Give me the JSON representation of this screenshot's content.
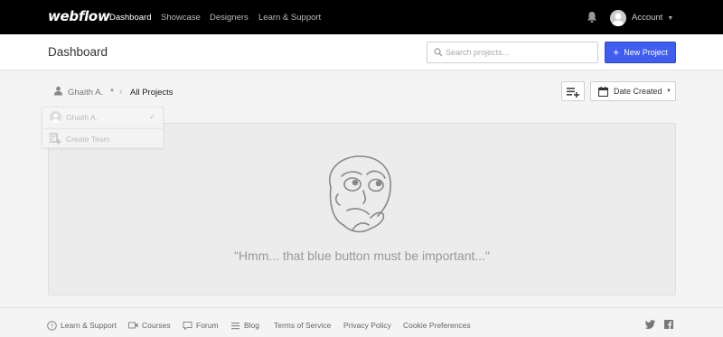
{
  "nav": {
    "logo": "webflow",
    "links": [
      "Dashboard",
      "Showcase",
      "Designers",
      "Learn & Support"
    ],
    "account_label": "Account"
  },
  "header": {
    "title": "Dashboard",
    "search_placeholder": "Search projects...",
    "new_project_label": "New Project"
  },
  "breadcrumb": {
    "user": "Ghaith A.",
    "current": "All Projects"
  },
  "sort": {
    "label": "Date Created"
  },
  "dropdown": {
    "items": [
      "Ghaith A.",
      "Create Team"
    ]
  },
  "empty_state": {
    "message": "\"Hmm... that blue button must be important...\""
  },
  "footer": {
    "links": [
      "Learn & Support",
      "Courses",
      "Forum",
      "Blog",
      "Terms of Service",
      "Privacy Policy",
      "Cookie Preferences"
    ],
    "social": [
      "twitter-icon",
      "facebook-icon"
    ]
  },
  "colors": {
    "accent": "#3f5ef0",
    "nav_bg": "#000000"
  }
}
